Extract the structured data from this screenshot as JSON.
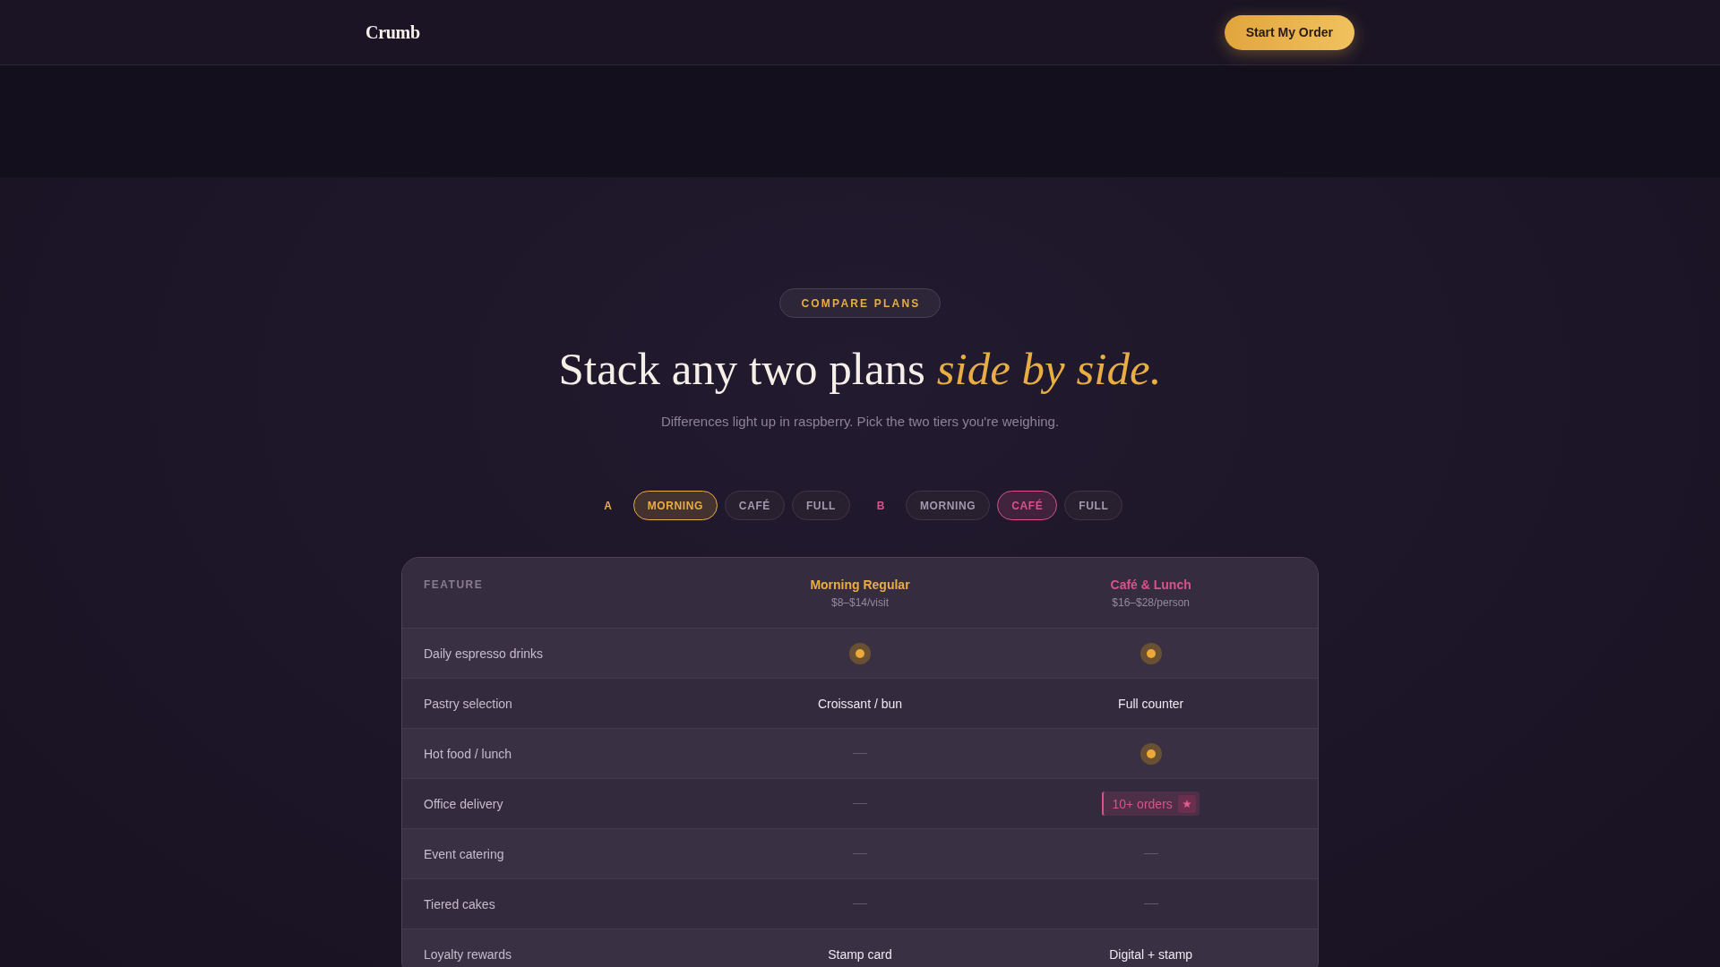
{
  "nav": {
    "logo": "Crumb",
    "cta": "Start My Order"
  },
  "hero": {
    "eyebrow": "COMPARE PLANS",
    "title": "Stack any two plans *side by side.*",
    "subtitle": "Differences light up in raspberry. Pick the two tiers you're weighing."
  },
  "selectors": [
    {
      "label": "A",
      "color": "#e9ad45",
      "options": [
        {
          "label": "MORNING",
          "selected": true
        },
        {
          "label": "CAFÉ",
          "selected": false
        },
        {
          "label": "FULL",
          "selected": false
        }
      ]
    },
    {
      "label": "B",
      "color": "#d9538a",
      "options": [
        {
          "label": "MORNING",
          "selected": false
        },
        {
          "label": "CAFÉ",
          "selected": true
        },
        {
          "label": "FULL",
          "selected": false
        }
      ]
    }
  ],
  "table": {
    "feature_heading": "FEATURE",
    "plans": [
      {
        "name": "Morning Regular",
        "price": "$8–$14/visit",
        "color": "#e9ad45"
      },
      {
        "name": "Café & Lunch",
        "price": "$16–$28/person",
        "color": "#d9538a"
      }
    ],
    "rows": [
      {
        "feature": "Daily espresso drinks",
        "cells": [
          {
            "kind": "yes"
          },
          {
            "kind": "yes"
          }
        ]
      },
      {
        "feature": "Pastry selection",
        "cells": [
          {
            "kind": "text",
            "text": "Croissant / bun"
          },
          {
            "kind": "text",
            "text": "Full counter"
          }
        ]
      },
      {
        "feature": "Hot food / lunch",
        "cells": [
          {
            "kind": "no"
          },
          {
            "kind": "yes"
          }
        ]
      },
      {
        "feature": "Office delivery",
        "cells": [
          {
            "kind": "no"
          },
          {
            "kind": "tag",
            "text": "10+ orders"
          }
        ]
      },
      {
        "feature": "Event catering",
        "cells": [
          {
            "kind": "no"
          },
          {
            "kind": "no"
          }
        ]
      },
      {
        "feature": "Tiered cakes",
        "cells": [
          {
            "kind": "no"
          },
          {
            "kind": "no"
          }
        ]
      },
      {
        "feature": "Loyalty rewards",
        "cells": [
          {
            "kind": "text",
            "text": "Stamp card"
          },
          {
            "kind": "text",
            "text": "Digital + stamp"
          }
        ]
      }
    ]
  }
}
